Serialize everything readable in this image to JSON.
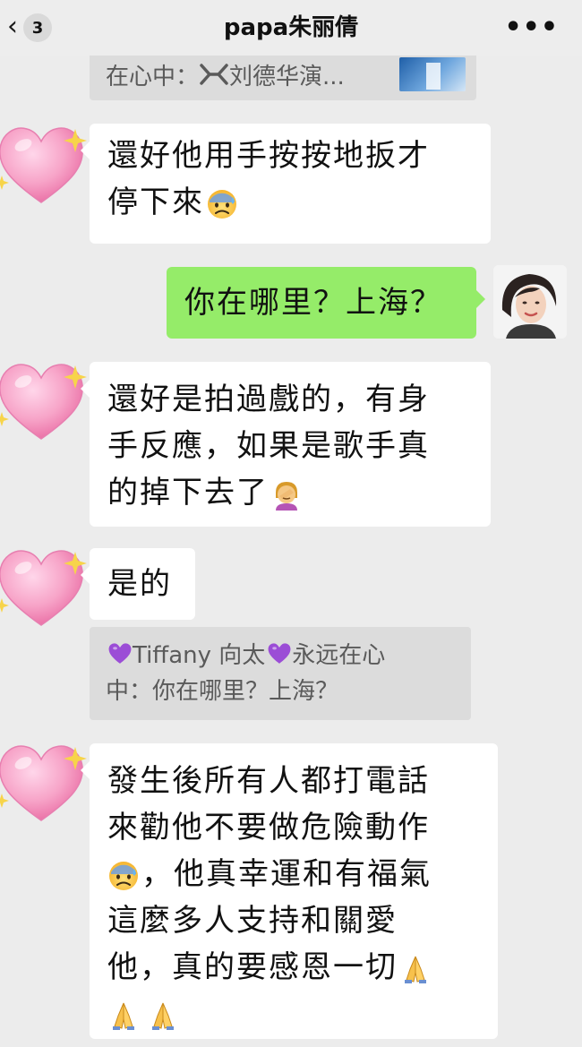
{
  "header": {
    "back_icon": "chevron-left-icon",
    "unread_count": "3",
    "title": "papa朱丽倩",
    "more_icon": "more-dots-icon",
    "more_label": "•••"
  },
  "messages": {
    "quote_top": "在心中：",
    "quote_top_name": "刘德华演...",
    "m1_line1": "還好他用手按按地扳才",
    "m1_line2": "停下來",
    "m2": "你在哪里？上海？",
    "m3_line1": "還好是拍過戲的，有身",
    "m3_line2": "手反應，如果是歌手真",
    "m3_line3": "的掉下去了",
    "m4": "是的",
    "quote_mid_line1_name": "Tiffany 向太",
    "quote_mid_line1_rest": "永远在心",
    "quote_mid_line2": "中：你在哪里？上海？",
    "m5_line1": "發生後所有人都打電話",
    "m5_line2": "來勸他不要做危險動作",
    "m5_line3": "，他真幸運和有福氣",
    "m5_line4": "這麼多人支持和關愛",
    "m5_line5": "他，真的要感恩一切"
  },
  "colors": {
    "background": "#ececec",
    "bubble_self": "#95ec69",
    "bubble_other": "#ffffff",
    "quote_bg": "#dcdcdc",
    "heart_pink": "#f7a4c8",
    "sparkle_yellow": "#f7d44a"
  },
  "icons": {
    "other_avatar": "pink-heart-sparkle-icon",
    "anxious_emoji": "anxious-sweat-face-icon",
    "facepalm_emoji": "facepalm-icon",
    "pray_emoji": "folded-hands-icon",
    "purple_heart": "purple-heart-icon"
  }
}
